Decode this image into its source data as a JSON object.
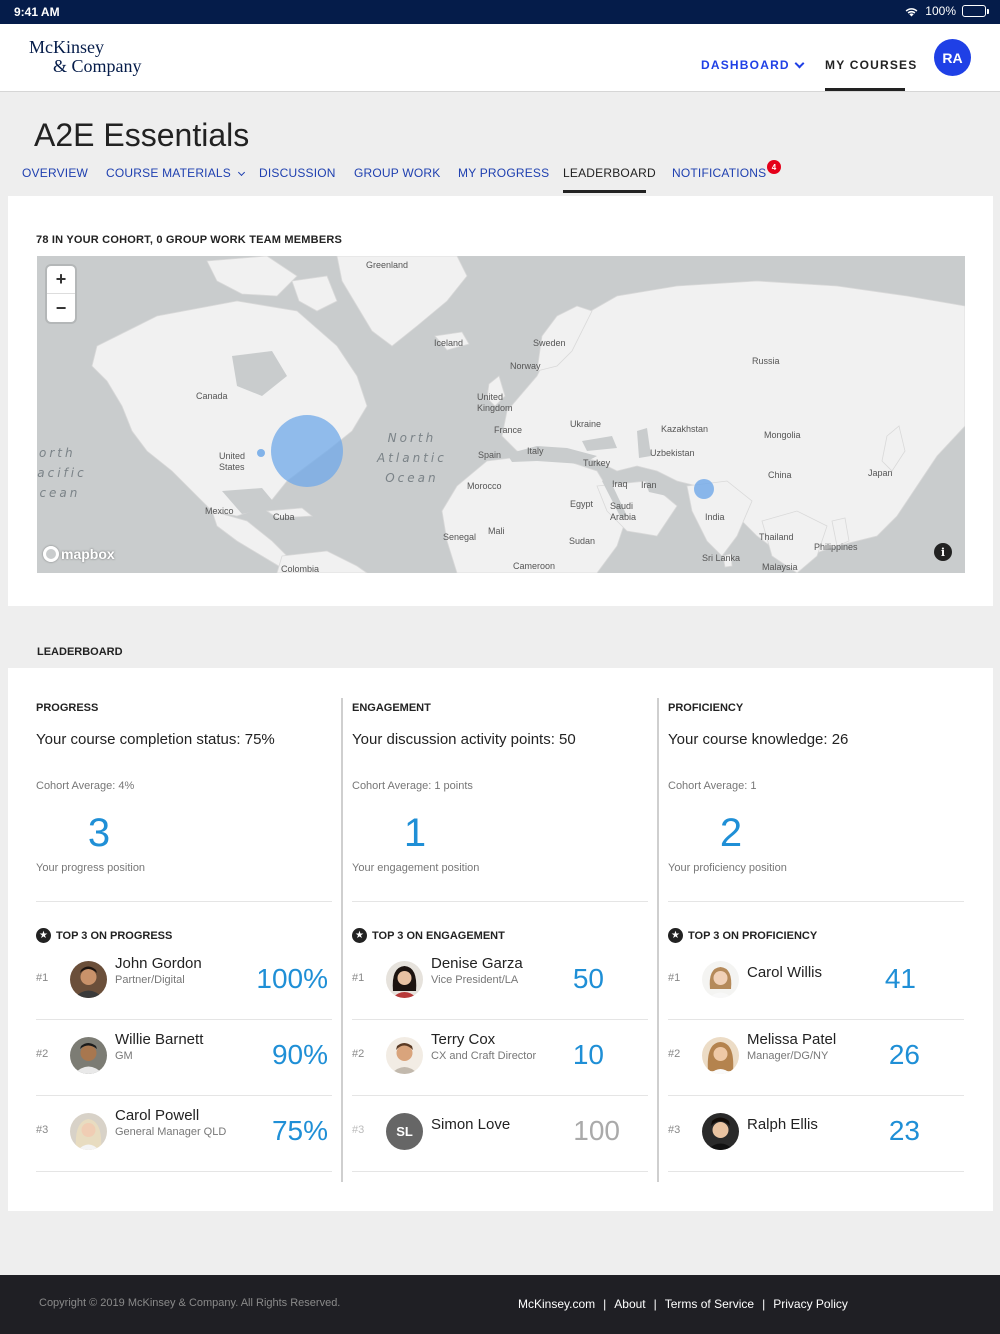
{
  "status_bar": {
    "time": "9:41 AM",
    "battery": "100%"
  },
  "brand": {
    "line1": "McKinsey",
    "line2": "& Company"
  },
  "topnav": {
    "dashboard": "DASHBOARD",
    "my_courses": "MY COURSES",
    "avatar_initials": "RA"
  },
  "page_title": "A2E Essentials",
  "tabs": [
    {
      "label": "OVERVIEW"
    },
    {
      "label": "COURSE MATERIALS"
    },
    {
      "label": "DISCUSSION"
    },
    {
      "label": "GROUP WORK"
    },
    {
      "label": "MY PROGRESS"
    },
    {
      "label": "LEADERBOARD"
    },
    {
      "label": "NOTIFICATIONS",
      "badge": "4"
    }
  ],
  "active_tab": "LEADERBOARD",
  "cohort_label": "78 IN YOUR COHORT, 0 GROUP WORK TEAM MEMBERS",
  "map": {
    "zoom_in": "+",
    "zoom_out": "−",
    "attribution": "mapbox",
    "info": "i",
    "labels": {
      "greenland": "Greenland",
      "iceland": "Iceland",
      "sweden": "Sweden",
      "norway": "Norway",
      "russia": "Russia",
      "canada": "Canada",
      "uk": "United Kingdom",
      "france": "France",
      "ukraine": "Ukraine",
      "kazakhstan": "Kazakhstan",
      "mongolia": "Mongolia",
      "us": "United States",
      "spain": "Spain",
      "italy": "Italy",
      "turkey": "Turkey",
      "uzbekistan": "Uzbekistan",
      "china": "China",
      "japan": "Japan",
      "iraq": "Iraq",
      "iran": "Iran",
      "morocco": "Morocco",
      "egypt": "Egypt",
      "saudi": "Saudi Arabia",
      "india": "India",
      "mexico": "Mexico",
      "cuba": "Cuba",
      "mali": "Mali",
      "senegal": "Senegal",
      "sudan": "Sudan",
      "thailand": "Thailand",
      "philippines": "Philippines",
      "srilanka": "Sri Lanka",
      "malaysia": "Malaysia",
      "colombia": "Colombia",
      "cameroon": "Cameroon"
    },
    "ocean_pacific": [
      "North",
      "Pacific",
      "Ocean"
    ],
    "ocean_atlantic": [
      "North",
      "Atlantic",
      "Ocean"
    ],
    "marker_color": "#6fa8e8"
  },
  "leaderboard": {
    "heading": "LEADERBOARD",
    "columns": [
      {
        "title": "PROGRESS",
        "status": "Your course completion status: 75%",
        "avg": "Cohort Average: 4%",
        "position": "3",
        "position_label": "Your progress position",
        "top3_label": "TOP 3 ON PROGRESS",
        "rows": [
          {
            "rank": "#1",
            "name": "John Gordon",
            "role": "Partner/Digital",
            "score": "100%"
          },
          {
            "rank": "#2",
            "name": "Willie Barnett",
            "role": "GM",
            "score": "90%"
          },
          {
            "rank": "#3",
            "name": "Carol Powell",
            "role": "General Manager QLD",
            "score": "75%"
          }
        ]
      },
      {
        "title": "ENGAGEMENT",
        "status": "Your discussion activity points: 50",
        "avg": "Cohort Average: 1 points",
        "position": "1",
        "position_label": "Your engagement position",
        "top3_label": "TOP 3 ON ENGAGEMENT",
        "rows": [
          {
            "rank": "#1",
            "name": "Denise Garza",
            "role": "Vice President/LA",
            "score": "50"
          },
          {
            "rank": "#2",
            "name": "Terry Cox",
            "role": "CX and Craft Director",
            "score": "10"
          },
          {
            "rank": "#3",
            "name": "Simon Love",
            "role": "",
            "score": "100",
            "initials": "SL"
          }
        ]
      },
      {
        "title": "PROFICIENCY",
        "status": "Your course knowledge: 26",
        "avg": "Cohort Average: 1",
        "position": "2",
        "position_label": "Your proficiency position",
        "top3_label": "TOP 3 ON PROFICIENCY",
        "rows": [
          {
            "rank": "#1",
            "name": "Carol Willis",
            "role": "",
            "score": "41"
          },
          {
            "rank": "#2",
            "name": "Melissa Patel",
            "role": "Manager/DG/NY",
            "score": "26"
          },
          {
            "rank": "#3",
            "name": "Ralph Ellis",
            "role": "",
            "score": "23"
          }
        ]
      }
    ]
  },
  "footer": {
    "copyright": "Copyright © 2019 McKinsey & Company. All Rights Reserved.",
    "links": [
      "McKinsey.com",
      "About",
      "Terms of Service",
      "Privacy Policy"
    ],
    "separator": "|"
  }
}
